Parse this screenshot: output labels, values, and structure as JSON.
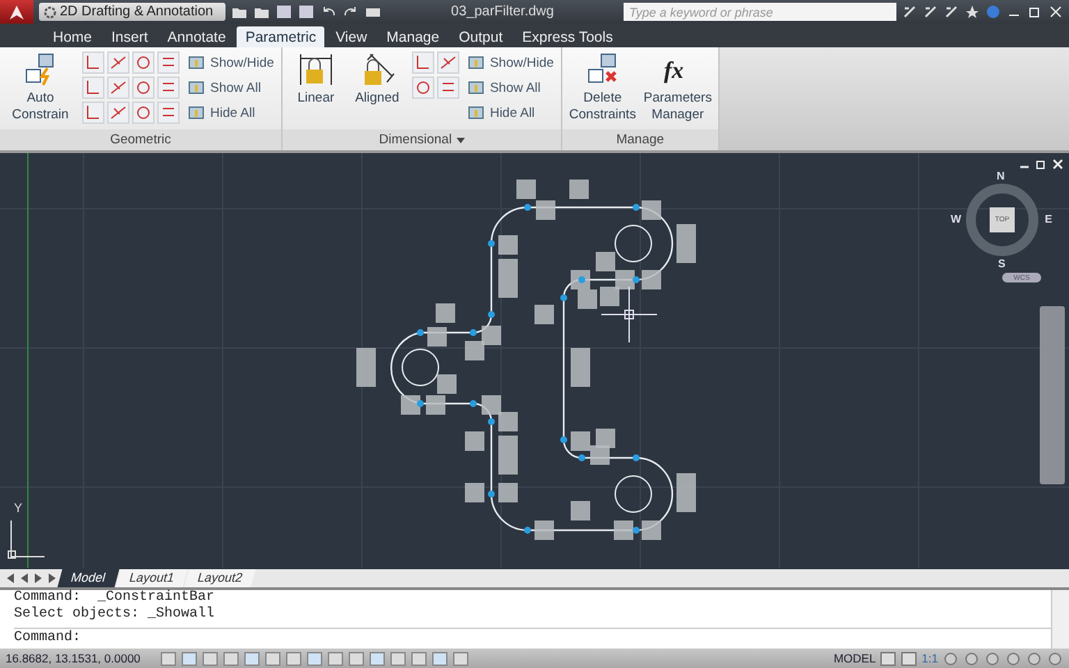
{
  "title_bar": {
    "workspace": "2D Drafting & Annotation",
    "file": "03_parFilter.dwg",
    "search": {
      "placeholder": "Type a keyword or phrase"
    }
  },
  "ribbon_tabs": [
    {
      "label": "Home",
      "selected": false
    },
    {
      "label": "Insert",
      "selected": false
    },
    {
      "label": "Annotate",
      "selected": false
    },
    {
      "label": "Parametric",
      "selected": true
    },
    {
      "label": "View",
      "selected": false
    },
    {
      "label": "Manage",
      "selected": false
    },
    {
      "label": "Output",
      "selected": false
    },
    {
      "label": "Express Tools",
      "selected": false
    }
  ],
  "panels": [
    {
      "title": "Geometric",
      "kind": "geometric",
      "large_tools": [
        {
          "label": "Auto Constrain",
          "kind": "auto"
        }
      ],
      "small_tools": [
        "Show/Hide",
        "Show All",
        "Hide All"
      ]
    },
    {
      "title": "Dimensional",
      "kind": "dimensional",
      "large_tools": [
        {
          "label": "Linear",
          "kind": "linear"
        },
        {
          "label": "Aligned",
          "kind": "aligned"
        }
      ],
      "small_tools": [
        "Show/Hide",
        "Show All",
        "Hide All"
      ]
    },
    {
      "title": "Manage",
      "kind": "manage",
      "large_tools": [
        {
          "label": "Delete Constraints",
          "kind": "delete"
        },
        {
          "label": "Parameters Manager",
          "kind": "fx",
          "glyph": "fx"
        }
      ]
    }
  ],
  "viewcube": {
    "north": "N",
    "east": "E",
    "south": "S",
    "west": "W",
    "face": "TOP",
    "wcs": "WCS"
  },
  "ucs": {
    "y_label": "Y"
  },
  "layout_tabs": [
    {
      "label": "Model",
      "selected": true
    },
    {
      "label": "Layout1",
      "selected": false
    },
    {
      "label": "Layout2",
      "selected": false
    }
  ],
  "command_history": [
    "Command:  _ConstraintBar",
    "Select objects: _Showall"
  ],
  "command_prompt": "Command:",
  "status_bar": {
    "coordinates": "16.8682, 13.1531, 0.0000",
    "space": "MODEL",
    "scale": "1:1"
  }
}
